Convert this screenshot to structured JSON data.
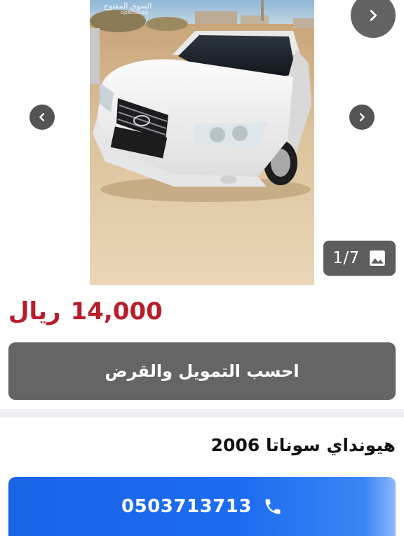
{
  "gallery": {
    "counter": "1/7",
    "watermark": "السوق المفتوح opensooq",
    "icons": {
      "next_top": "chevron-right-icon",
      "prev": "chevron-left-icon",
      "next": "chevron-right-icon",
      "counter": "image-icon"
    }
  },
  "listing": {
    "price_amount": "14,000",
    "price_currency": "ريال",
    "finance_button_label": "احسب التمويل والقرض",
    "title": "هيونداي سوناتا 2006",
    "phone": "0503713713",
    "phone_icon": "phone-icon"
  },
  "colors": {
    "price": "#b71d2b",
    "call_button": "#1d6cf0",
    "finance_button": "#656565"
  }
}
